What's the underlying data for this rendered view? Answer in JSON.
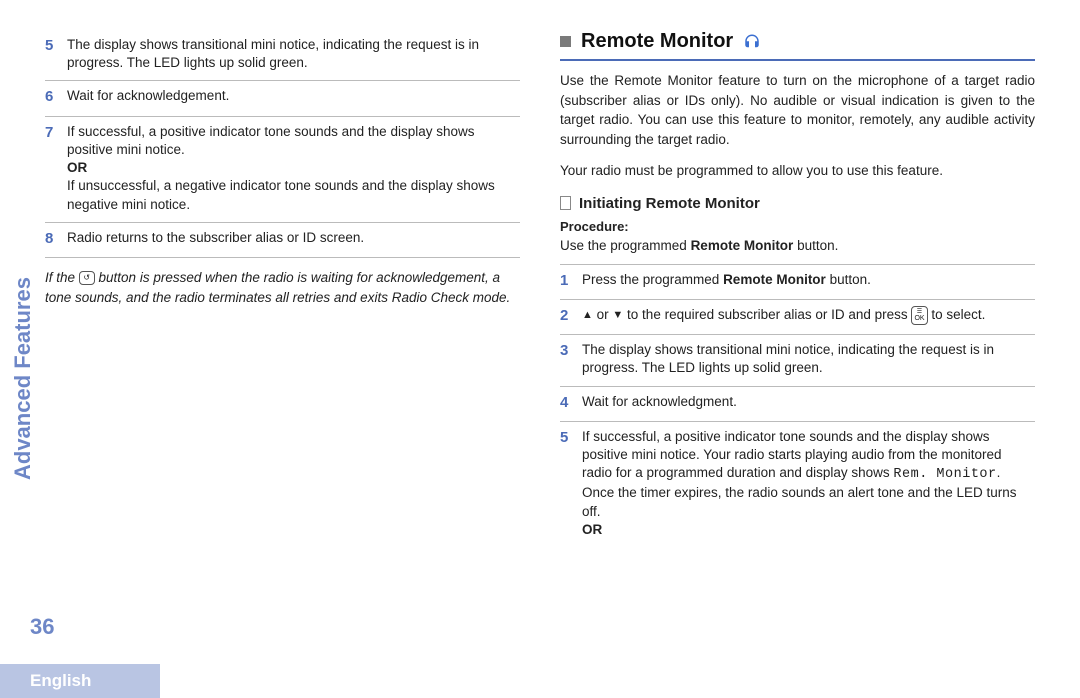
{
  "sidebar": {
    "label": "Advanced Features"
  },
  "page_number": "36",
  "language": "English",
  "left": {
    "steps": [
      {
        "num": "5",
        "text": "The display shows transitional mini notice, indicating the request is in progress. The LED lights up solid green."
      },
      {
        "num": "6",
        "text": "Wait for acknowledgement."
      },
      {
        "num": "7",
        "line1": "If successful, a positive indicator tone sounds and the display shows positive mini notice.",
        "or": "OR",
        "line2": "If unsuccessful, a negative indicator tone sounds and the display shows negative mini notice."
      },
      {
        "num": "8",
        "text": "Radio returns to the subscriber alias or ID screen."
      }
    ],
    "note_pre": "If the ",
    "note_post": " button is pressed when the radio is waiting for acknowledgement, a tone sounds, and the radio terminates all retries and exits Radio Check mode."
  },
  "right": {
    "heading": "Remote Monitor",
    "para1": "Use the Remote Monitor feature to turn on the microphone of a target radio (subscriber alias or IDs only). No audible or visual indication is given to the target radio. You can use this feature to monitor, remotely, any audible activity surrounding the target radio.",
    "para2": "Your radio must be programmed to allow you to use this feature.",
    "subheading": "Initiating Remote Monitor",
    "proc_label": "Procedure:",
    "proc_text_pre": "Use the programmed ",
    "proc_text_bold": "Remote Monitor",
    "proc_text_post": " button.",
    "steps": [
      {
        "num": "1",
        "pre": "Press the programmed ",
        "bold": "Remote Monitor",
        "post": " button."
      },
      {
        "num": "2",
        "mid": " or ",
        "after_arrows": " to the required subscriber alias or ID and press ",
        "tail": " to select."
      },
      {
        "num": "3",
        "text": "The display shows transitional mini notice, indicating the request is in progress. The LED lights up solid green."
      },
      {
        "num": "4",
        "text": "Wait for acknowledgment."
      },
      {
        "num": "5",
        "l1": "If successful, a positive indicator tone sounds and the display shows positive mini notice. Your radio starts playing audio from the monitored radio for a programmed duration and display shows ",
        "code": "Rem. Monitor",
        "l1b": ".",
        "l2": "Once the timer expires, the radio sounds an alert tone and the LED turns off.",
        "or": "OR"
      }
    ]
  },
  "icons": {
    "back_btn": "⮐",
    "ok_top": "☰",
    "ok_bottom": "OK"
  }
}
